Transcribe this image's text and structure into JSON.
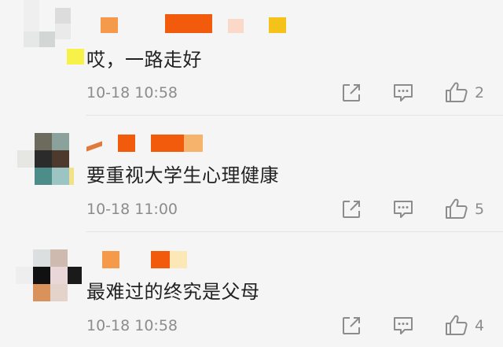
{
  "comments": [
    {
      "text": "哎，一路走好",
      "time": "10-18 10:58",
      "likes": "2",
      "icons": [
        "share-icon",
        "comment-icon",
        "like-icon"
      ]
    },
    {
      "text": "要重视大学生心理健康",
      "time": "10-18 11:00",
      "likes": "5",
      "icons": [
        "share-icon",
        "comment-icon",
        "like-icon"
      ]
    },
    {
      "text": "最难过的终究是父母",
      "time": "10-18 10:58",
      "likes": "4",
      "icons": [
        "share-icon",
        "comment-icon",
        "like-icon"
      ]
    }
  ],
  "colors": {
    "text": "#222222",
    "meta": "#8c8c8c",
    "background": "#f5f5f5",
    "accent_orange": "#f25b0c",
    "accent_yellow": "#f5c21a"
  }
}
